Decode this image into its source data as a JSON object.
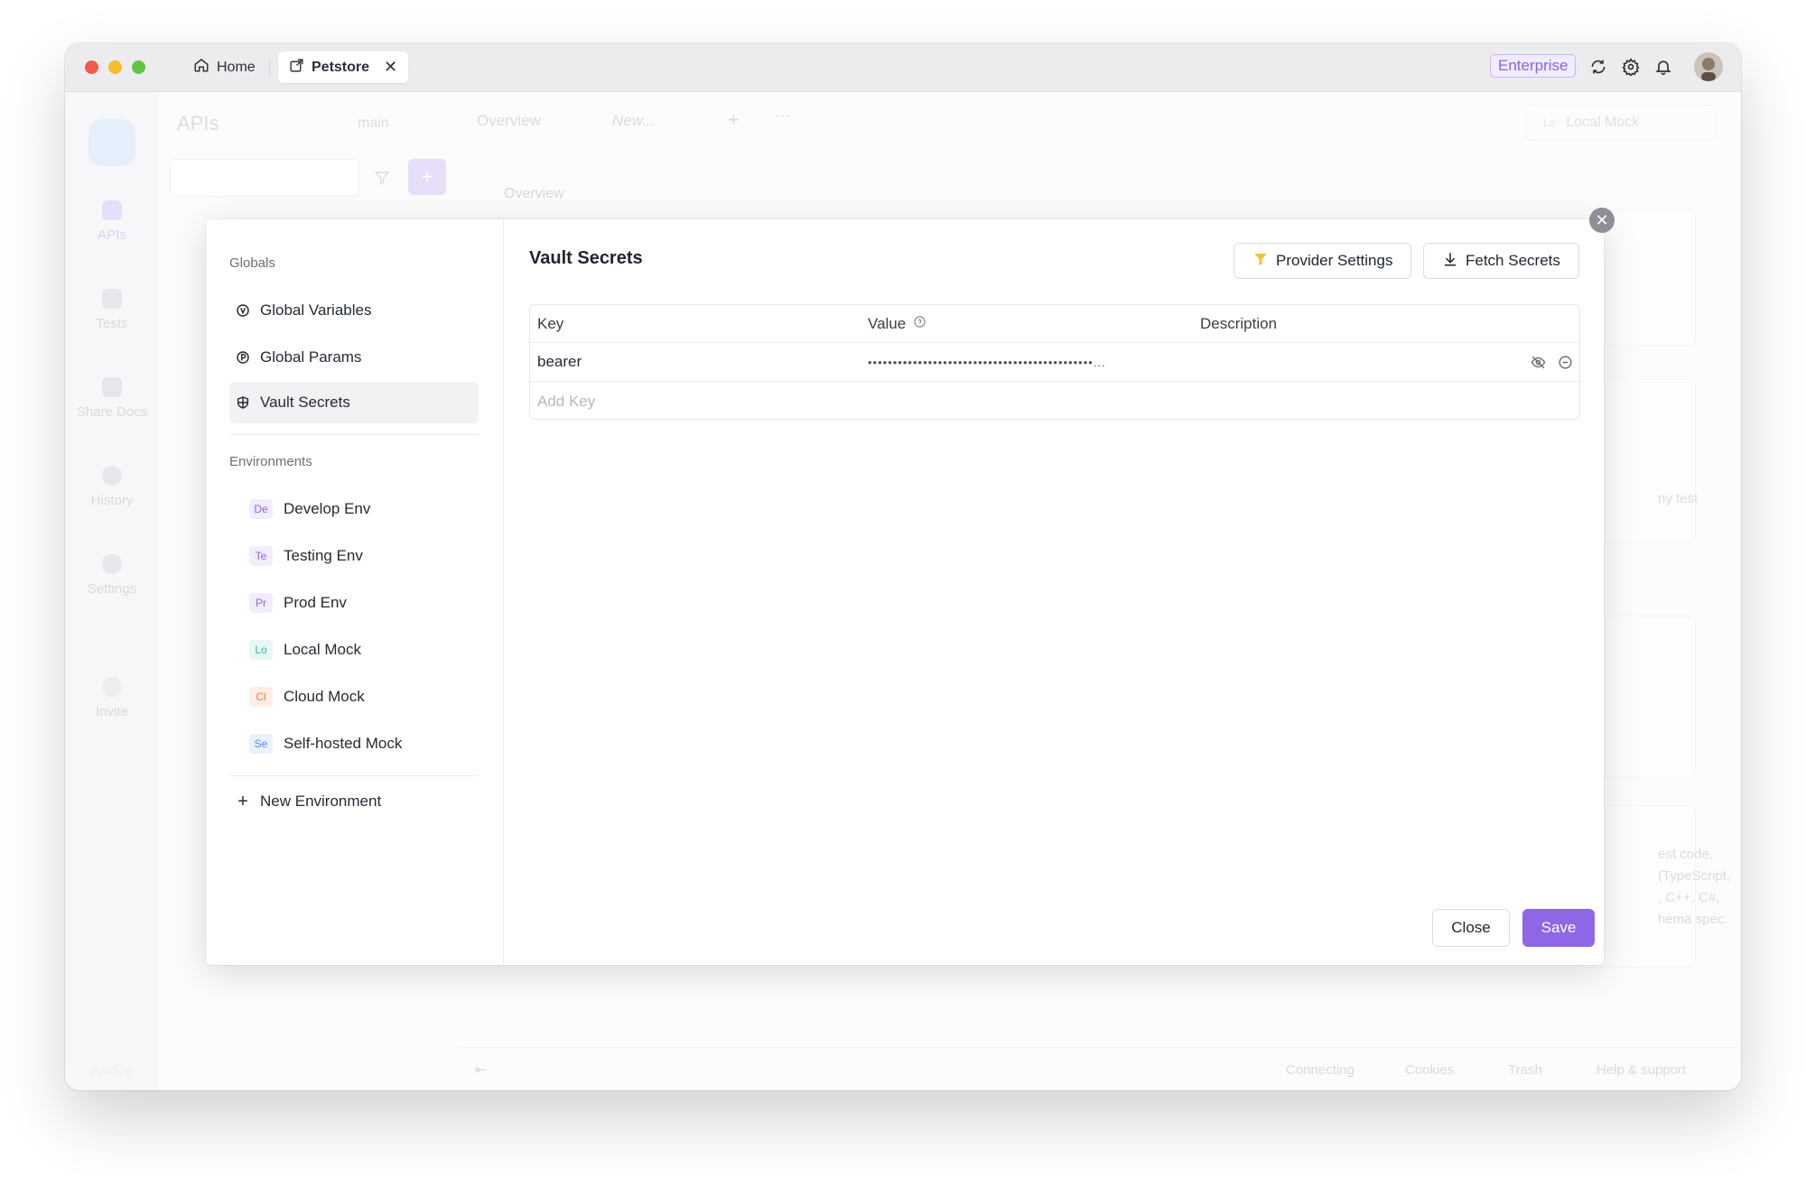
{
  "titlebar": {
    "tabs": [
      {
        "label": "Home"
      },
      {
        "label": "Petstore"
      }
    ],
    "enterprise_label": "Enterprise"
  },
  "rail": {
    "items": [
      {
        "label": "APIs"
      },
      {
        "label": "Tests"
      },
      {
        "label": "Share Docs"
      },
      {
        "label": "History"
      },
      {
        "label": "Settings"
      },
      {
        "label": "Invite"
      }
    ],
    "bottom_label": "Apidog"
  },
  "apis_panel": {
    "title": "APIs",
    "branch": "main",
    "plus": "+"
  },
  "content_bg": {
    "tabs": [
      "Overview",
      "New..."
    ],
    "environment": "Local Mock",
    "environment_badge": "Lo",
    "overview_label": "Overview",
    "faint_text": [
      "ny test",
      "est code,",
      "(TypeScript,",
      ", C++, C#,",
      "hema spec."
    ],
    "footer": [
      "Connecting",
      "Cookies",
      "Trash",
      "Help & support"
    ]
  },
  "modal": {
    "globals_section": "Globals",
    "globals_items": [
      {
        "label": "Global Variables",
        "icon": "variable-icon"
      },
      {
        "label": "Global Params",
        "icon": "params-icon"
      },
      {
        "label": "Vault Secrets",
        "icon": "shield-icon",
        "active": true
      }
    ],
    "environments_section": "Environments",
    "environments": [
      {
        "badge": "De",
        "label": "Develop Env",
        "color": "#8e67e6",
        "bg": "#f1ecfe"
      },
      {
        "badge": "Te",
        "label": "Testing Env",
        "color": "#8e67e6",
        "bg": "#f1ecfe"
      },
      {
        "badge": "Pr",
        "label": "Prod Env",
        "color": "#8e67e6",
        "bg": "#f1ecfe"
      },
      {
        "badge": "Lo",
        "label": "Local Mock",
        "color": "#2fb8a7",
        "bg": "#e6f7f4"
      },
      {
        "badge": "Cl",
        "label": "Cloud Mock",
        "color": "#f07b3f",
        "bg": "#fdeee5"
      },
      {
        "badge": "Se",
        "label": "Self-hosted Mock",
        "color": "#4a8ff0",
        "bg": "#e8f1fd"
      }
    ],
    "new_environment": "New Environment",
    "title": "Vault Secrets",
    "provider_settings": "Provider Settings",
    "fetch_secrets": "Fetch Secrets",
    "table": {
      "headers": [
        "Key",
        "Value",
        "Description"
      ],
      "rows": [
        {
          "key": "bearer",
          "value": "•••••••••••••••••••••••••••••••••••••••••••••...",
          "description": ""
        }
      ],
      "add_key_placeholder": "Add Key"
    },
    "close_label": "Close",
    "save_label": "Save"
  }
}
